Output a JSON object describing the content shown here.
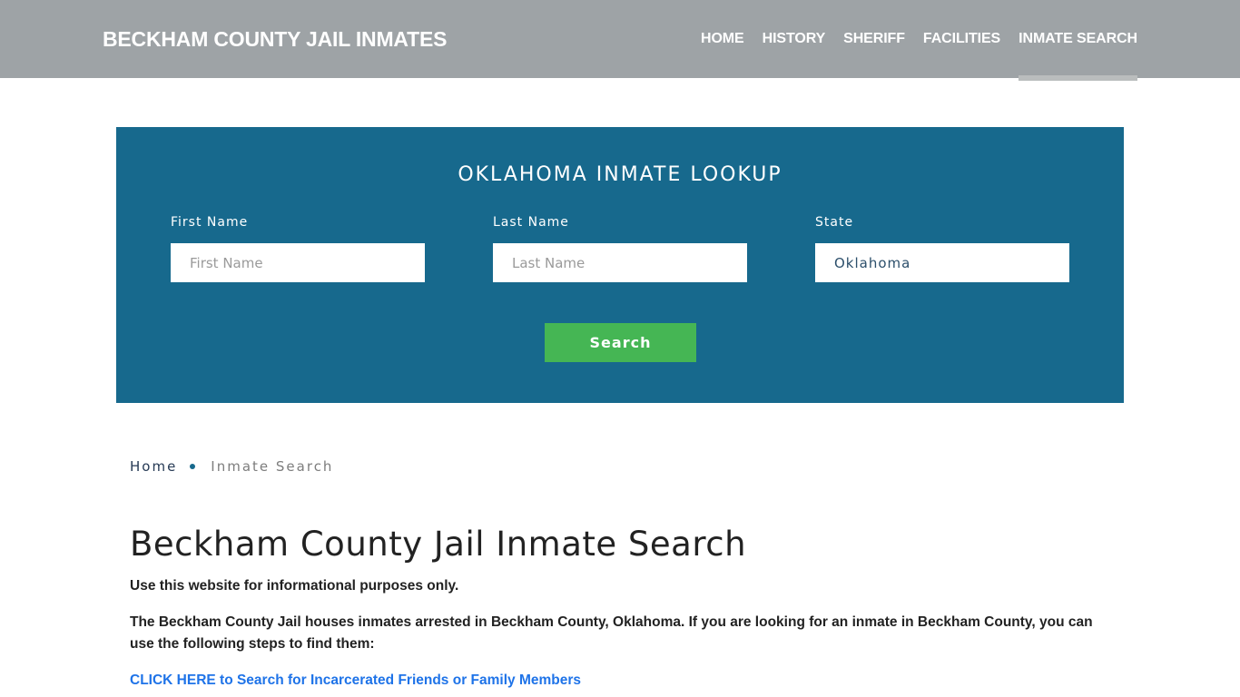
{
  "header": {
    "brand": "BECKHAM COUNTY JAIL INMATES",
    "nav": [
      {
        "label": "HOME",
        "active": false
      },
      {
        "label": "HISTORY",
        "active": false
      },
      {
        "label": "SHERIFF",
        "active": false
      },
      {
        "label": "FACILITIES",
        "active": false
      },
      {
        "label": "INMATE SEARCH",
        "active": true
      }
    ]
  },
  "lookup": {
    "title": "OKLAHOMA INMATE LOOKUP",
    "first_name": {
      "label": "First Name",
      "placeholder": "First Name",
      "value": ""
    },
    "last_name": {
      "label": "Last Name",
      "placeholder": "Last Name",
      "value": ""
    },
    "state": {
      "label": "State",
      "value": "Oklahoma"
    },
    "search_label": "Search",
    "colors": {
      "background": "#17698d",
      "button": "#45b654"
    }
  },
  "breadcrumb": {
    "home": "Home",
    "current": "Inmate Search"
  },
  "content": {
    "title": "Beckham County Jail Inmate Search",
    "paragraphs": [
      "Use this website for informational purposes only.",
      "The Beckham County Jail houses inmates arrested in Beckham County, Oklahoma. If you are looking for an inmate in Beckham County, you can use the following steps to find them:"
    ],
    "cta_link": "CLICK HERE to Search for Incarcerated Friends or Family Members",
    "link_color": "#1e73e8"
  }
}
